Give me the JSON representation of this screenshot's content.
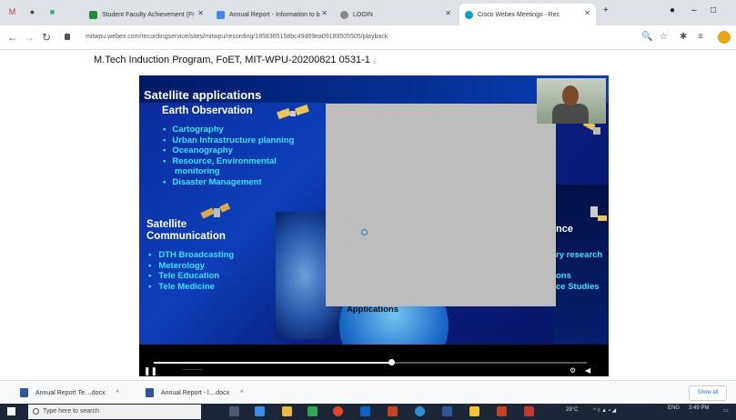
{
  "browser": {
    "tabs": [
      {
        "title": "Student Faculty Achievement (Fr",
        "active": false
      },
      {
        "title": "Annual Report - Information to b",
        "active": false
      },
      {
        "title": "LOGIN",
        "active": false
      },
      {
        "title": "Cisco Webex Meetings - Rec",
        "active": true
      }
    ],
    "new_tab": "+",
    "url": "mitwpu.webex.com/recordingservice/sites/mitwpu/recording/1858365158bc49d69ea09189505505/playback"
  },
  "page": {
    "title": "M.Tech Induction Program, FoET, MIT-WPU-20200821 0531-1"
  },
  "slide": {
    "title": "Satellite applications",
    "earth_observation": {
      "heading": "Earth Observation",
      "items": [
        "Cartography",
        "Urban Infrastructure planning",
        "Oceanography",
        "Resource, Environmental",
        "monitoring",
        "Disaster Management"
      ]
    },
    "communication": {
      "heading_line1": "Satellite",
      "heading_line2": "Communication",
      "items": [
        "DTH Broadcasting",
        "Meterology",
        "Tele Education",
        "Tele Medicine"
      ]
    },
    "right_partial": {
      "heading": "nce",
      "line1": "ry research",
      "line2": "ons",
      "line3": "ce Studies"
    },
    "center_label": "Applications"
  },
  "player": {
    "progress": 0.55
  },
  "downloads": {
    "items": [
      {
        "name": "Annual Report Te....docx"
      },
      {
        "name": "Annual Report - l....docx"
      }
    ],
    "show_all": "Show all"
  },
  "taskbar": {
    "search_placeholder": "Type here to search",
    "weather": "29°C",
    "lang": "ENG",
    "time": "3:49 PM"
  },
  "colors": {
    "accent_cyan": "#3fe0ff",
    "slide_blue": "#0d3fb8"
  }
}
